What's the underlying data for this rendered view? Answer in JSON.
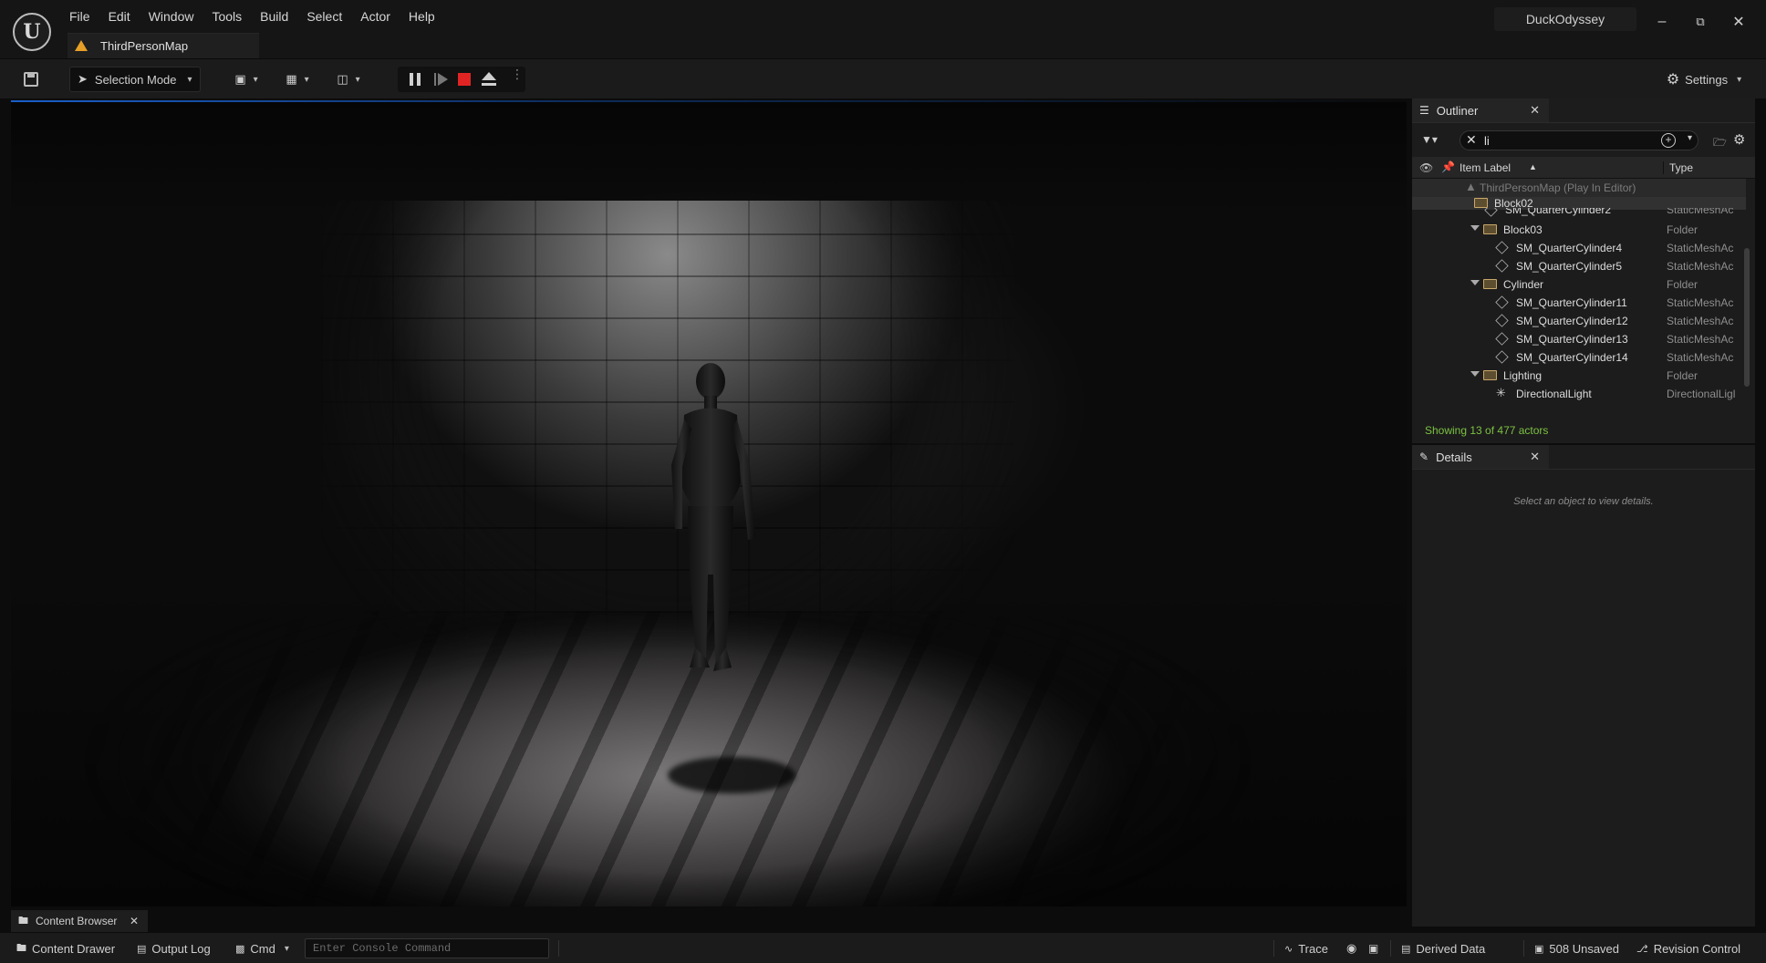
{
  "app": {
    "menu": [
      "File",
      "Edit",
      "Window",
      "Tools",
      "Build",
      "Select",
      "Actor",
      "Help"
    ],
    "map_tab": "ThirdPersonMap",
    "project": "DuckOdyssey"
  },
  "toolbar": {
    "mode_label": "Selection Mode",
    "settings_label": "Settings"
  },
  "outliner": {
    "tab_label": "Outliner",
    "search_value": "li",
    "col_label": "Item Label",
    "col_type": "Type",
    "rows": [
      {
        "name": "ThirdPersonMap (Play In Editor)",
        "type": ""
      },
      {
        "name": "Block02",
        "type": ""
      },
      {
        "name": "SM_QuarterCylinder2",
        "type": "StaticMeshAc"
      },
      {
        "name": "Block03",
        "type": "Folder"
      },
      {
        "name": "SM_QuarterCylinder4",
        "type": "StaticMeshAc"
      },
      {
        "name": "SM_QuarterCylinder5",
        "type": "StaticMeshAc"
      },
      {
        "name": "Cylinder",
        "type": "Folder"
      },
      {
        "name": "SM_QuarterCylinder11",
        "type": "StaticMeshAc"
      },
      {
        "name": "SM_QuarterCylinder12",
        "type": "StaticMeshAc"
      },
      {
        "name": "SM_QuarterCylinder13",
        "type": "StaticMeshAc"
      },
      {
        "name": "SM_QuarterCylinder14",
        "type": "StaticMeshAc"
      },
      {
        "name": "Lighting",
        "type": "Folder"
      },
      {
        "name": "DirectionalLight",
        "type": "DirectionalLigl"
      }
    ],
    "status": "Showing 13 of 477 actors"
  },
  "details": {
    "tab_label": "Details",
    "empty_msg": "Select an object to view details."
  },
  "bottom": {
    "content_browser": "Content Browser",
    "content_drawer": "Content Drawer",
    "output_log": "Output Log",
    "cmd": "Cmd",
    "console_placeholder": "Enter Console Command",
    "trace": "Trace",
    "derived_data": "Derived Data",
    "unsaved": "508 Unsaved",
    "revision_control": "Revision Control"
  },
  "colors": {
    "accent_green": "#7cc242",
    "stop_red": "#e02424",
    "warning_orange": "#e6a028"
  }
}
